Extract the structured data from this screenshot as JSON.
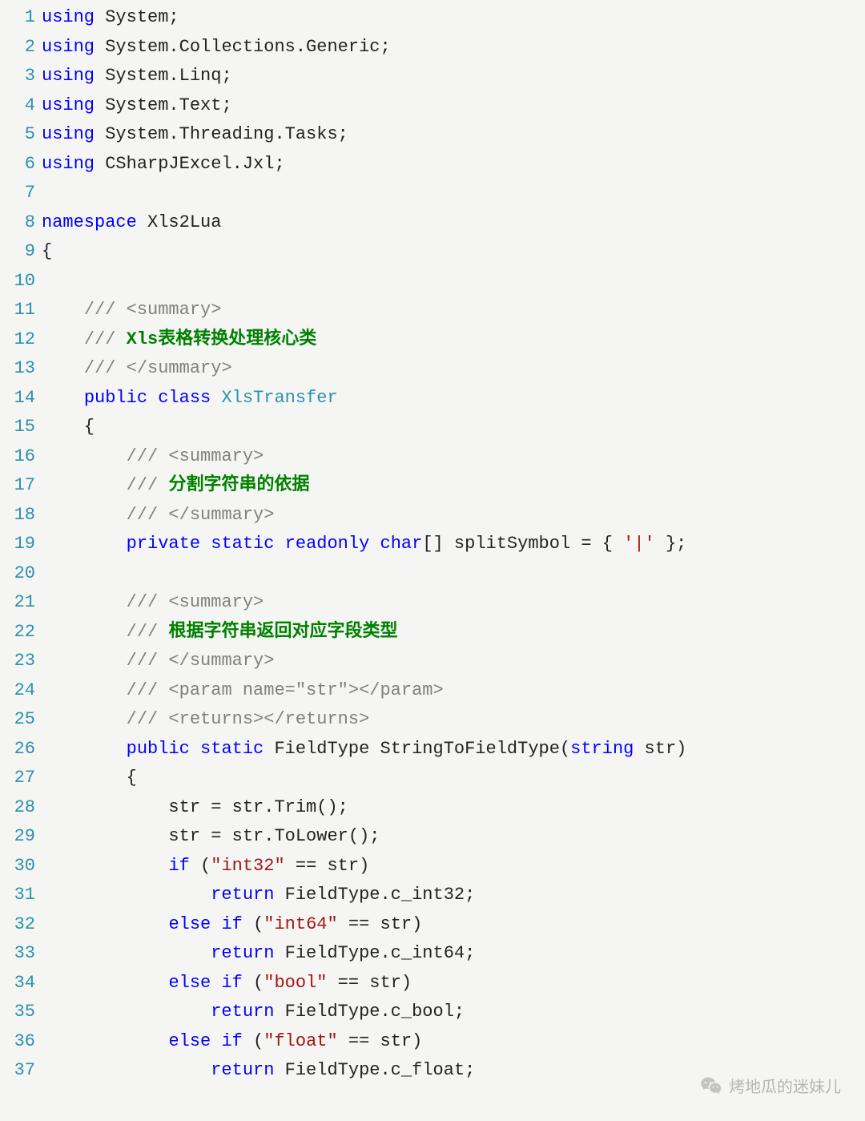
{
  "lines": [
    {
      "n": 1,
      "tokens": [
        [
          "kw",
          "using"
        ],
        [
          "plain",
          " System;"
        ]
      ]
    },
    {
      "n": 2,
      "tokens": [
        [
          "kw",
          "using"
        ],
        [
          "plain",
          " System.Collections.Generic;"
        ]
      ]
    },
    {
      "n": 3,
      "tokens": [
        [
          "kw",
          "using"
        ],
        [
          "plain",
          " System.Linq;"
        ]
      ]
    },
    {
      "n": 4,
      "tokens": [
        [
          "kw",
          "using"
        ],
        [
          "plain",
          " System.Text;"
        ]
      ]
    },
    {
      "n": 5,
      "tokens": [
        [
          "kw",
          "using"
        ],
        [
          "plain",
          " System.Threading.Tasks;"
        ]
      ]
    },
    {
      "n": 6,
      "tokens": [
        [
          "kw",
          "using"
        ],
        [
          "plain",
          " CSharpJExcel.Jxl;"
        ]
      ]
    },
    {
      "n": 7,
      "tokens": []
    },
    {
      "n": 8,
      "tokens": [
        [
          "kw",
          "namespace"
        ],
        [
          "plain",
          " Xls2Lua"
        ]
      ]
    },
    {
      "n": 9,
      "tokens": [
        [
          "plain",
          "{"
        ]
      ]
    },
    {
      "n": 10,
      "tokens": []
    },
    {
      "n": 11,
      "tokens": [
        [
          "plain",
          "    "
        ],
        [
          "com-tag",
          "/// <summary>"
        ]
      ]
    },
    {
      "n": 12,
      "tokens": [
        [
          "plain",
          "    "
        ],
        [
          "com-tag",
          "/// "
        ],
        [
          "com-green bold",
          "Xls表格转换处理核心类"
        ]
      ]
    },
    {
      "n": 13,
      "tokens": [
        [
          "plain",
          "    "
        ],
        [
          "com-tag",
          "/// </summary>"
        ]
      ]
    },
    {
      "n": 14,
      "tokens": [
        [
          "plain",
          "    "
        ],
        [
          "kw",
          "public"
        ],
        [
          "plain",
          " "
        ],
        [
          "kw",
          "class"
        ],
        [
          "plain",
          " "
        ],
        [
          "type",
          "XlsTransfer"
        ]
      ]
    },
    {
      "n": 15,
      "tokens": [
        [
          "plain",
          "    {"
        ]
      ]
    },
    {
      "n": 16,
      "tokens": [
        [
          "plain",
          "        "
        ],
        [
          "com-tag",
          "/// <summary>"
        ]
      ]
    },
    {
      "n": 17,
      "tokens": [
        [
          "plain",
          "        "
        ],
        [
          "com-tag",
          "/// "
        ],
        [
          "com-green bold",
          "分割字符串的依据"
        ]
      ]
    },
    {
      "n": 18,
      "tokens": [
        [
          "plain",
          "        "
        ],
        [
          "com-tag",
          "/// </summary>"
        ]
      ]
    },
    {
      "n": 19,
      "tokens": [
        [
          "plain",
          "        "
        ],
        [
          "kw",
          "private"
        ],
        [
          "plain",
          " "
        ],
        [
          "kw",
          "static"
        ],
        [
          "plain",
          " "
        ],
        [
          "kw",
          "readonly"
        ],
        [
          "plain",
          " "
        ],
        [
          "kw",
          "char"
        ],
        [
          "plain",
          "[] splitSymbol = { "
        ],
        [
          "str",
          "'|'"
        ],
        [
          "plain",
          " };"
        ]
      ]
    },
    {
      "n": 20,
      "tokens": []
    },
    {
      "n": 21,
      "tokens": [
        [
          "plain",
          "        "
        ],
        [
          "com-tag",
          "/// <summary>"
        ]
      ]
    },
    {
      "n": 22,
      "tokens": [
        [
          "plain",
          "        "
        ],
        [
          "com-tag",
          "/// "
        ],
        [
          "com-green bold",
          "根据字符串返回对应字段类型"
        ]
      ]
    },
    {
      "n": 23,
      "tokens": [
        [
          "plain",
          "        "
        ],
        [
          "com-tag",
          "/// </summary>"
        ]
      ]
    },
    {
      "n": 24,
      "tokens": [
        [
          "plain",
          "        "
        ],
        [
          "com-tag",
          "/// <param name=\"str\"></param>"
        ]
      ]
    },
    {
      "n": 25,
      "tokens": [
        [
          "plain",
          "        "
        ],
        [
          "com-tag",
          "/// <returns></returns>"
        ]
      ]
    },
    {
      "n": 26,
      "tokens": [
        [
          "plain",
          "        "
        ],
        [
          "kw",
          "public"
        ],
        [
          "plain",
          " "
        ],
        [
          "kw",
          "static"
        ],
        [
          "plain",
          " FieldType StringToFieldType("
        ],
        [
          "kw",
          "string"
        ],
        [
          "plain",
          " str)"
        ]
      ]
    },
    {
      "n": 27,
      "tokens": [
        [
          "plain",
          "        {"
        ]
      ]
    },
    {
      "n": 28,
      "tokens": [
        [
          "plain",
          "            str = str.Trim();"
        ]
      ]
    },
    {
      "n": 29,
      "tokens": [
        [
          "plain",
          "            str = str.ToLower();"
        ]
      ]
    },
    {
      "n": 30,
      "tokens": [
        [
          "plain",
          "            "
        ],
        [
          "kw",
          "if"
        ],
        [
          "plain",
          " ("
        ],
        [
          "str",
          "\"int32\""
        ],
        [
          "plain",
          " == str)"
        ]
      ]
    },
    {
      "n": 31,
      "tokens": [
        [
          "plain",
          "                "
        ],
        [
          "kw",
          "return"
        ],
        [
          "plain",
          " FieldType.c_int32;"
        ]
      ]
    },
    {
      "n": 32,
      "tokens": [
        [
          "plain",
          "            "
        ],
        [
          "kw",
          "else"
        ],
        [
          "plain",
          " "
        ],
        [
          "kw",
          "if"
        ],
        [
          "plain",
          " ("
        ],
        [
          "str",
          "\"int64\""
        ],
        [
          "plain",
          " == str)"
        ]
      ]
    },
    {
      "n": 33,
      "tokens": [
        [
          "plain",
          "                "
        ],
        [
          "kw",
          "return"
        ],
        [
          "plain",
          " FieldType.c_int64;"
        ]
      ]
    },
    {
      "n": 34,
      "tokens": [
        [
          "plain",
          "            "
        ],
        [
          "kw",
          "else"
        ],
        [
          "plain",
          " "
        ],
        [
          "kw",
          "if"
        ],
        [
          "plain",
          " ("
        ],
        [
          "str",
          "\"bool\""
        ],
        [
          "plain",
          " == str)"
        ]
      ]
    },
    {
      "n": 35,
      "tokens": [
        [
          "plain",
          "                "
        ],
        [
          "kw",
          "return"
        ],
        [
          "plain",
          " FieldType.c_bool;"
        ]
      ]
    },
    {
      "n": 36,
      "tokens": [
        [
          "plain",
          "            "
        ],
        [
          "kw",
          "else"
        ],
        [
          "plain",
          " "
        ],
        [
          "kw",
          "if"
        ],
        [
          "plain",
          " ("
        ],
        [
          "str",
          "\"float\""
        ],
        [
          "plain",
          " == str)"
        ]
      ]
    },
    {
      "n": 37,
      "tokens": [
        [
          "plain",
          "                "
        ],
        [
          "kw",
          "return"
        ],
        [
          "plain",
          " FieldType.c_float;"
        ]
      ]
    }
  ],
  "watermark": "烤地瓜的迷妹儿"
}
